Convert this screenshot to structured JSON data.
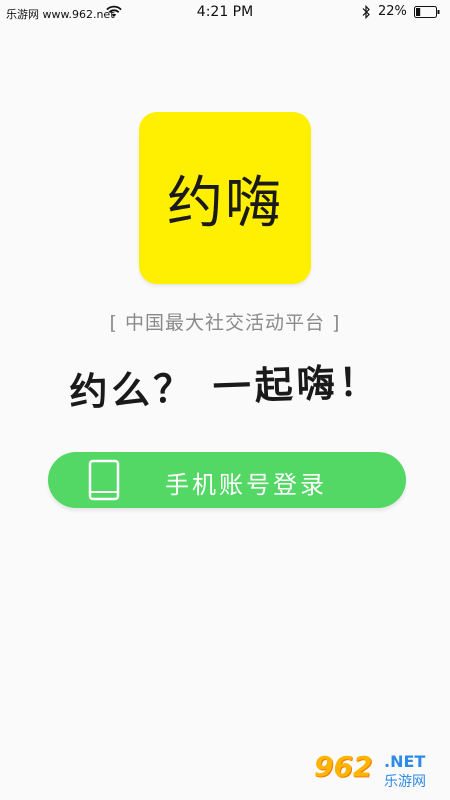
{
  "status_bar": {
    "carrier": "乐游网 www.962.net",
    "time": "4:21 PM",
    "battery_percent": "22%",
    "battery_level": 0.22,
    "icons": [
      "wifi-icon",
      "bluetooth-icon",
      "battery-icon"
    ]
  },
  "logo": {
    "text": "约嗨",
    "background_color": "#ffef00"
  },
  "tagline": "[ 中国最大社交活动平台 ]",
  "slogan": "约么？ 一起嗨！",
  "login_button": {
    "label": "手机账号登录",
    "icon": "phone-icon",
    "color": "#53d765"
  },
  "watermark": {
    "brand": "962",
    "net": ".NET",
    "site": "乐游网"
  }
}
